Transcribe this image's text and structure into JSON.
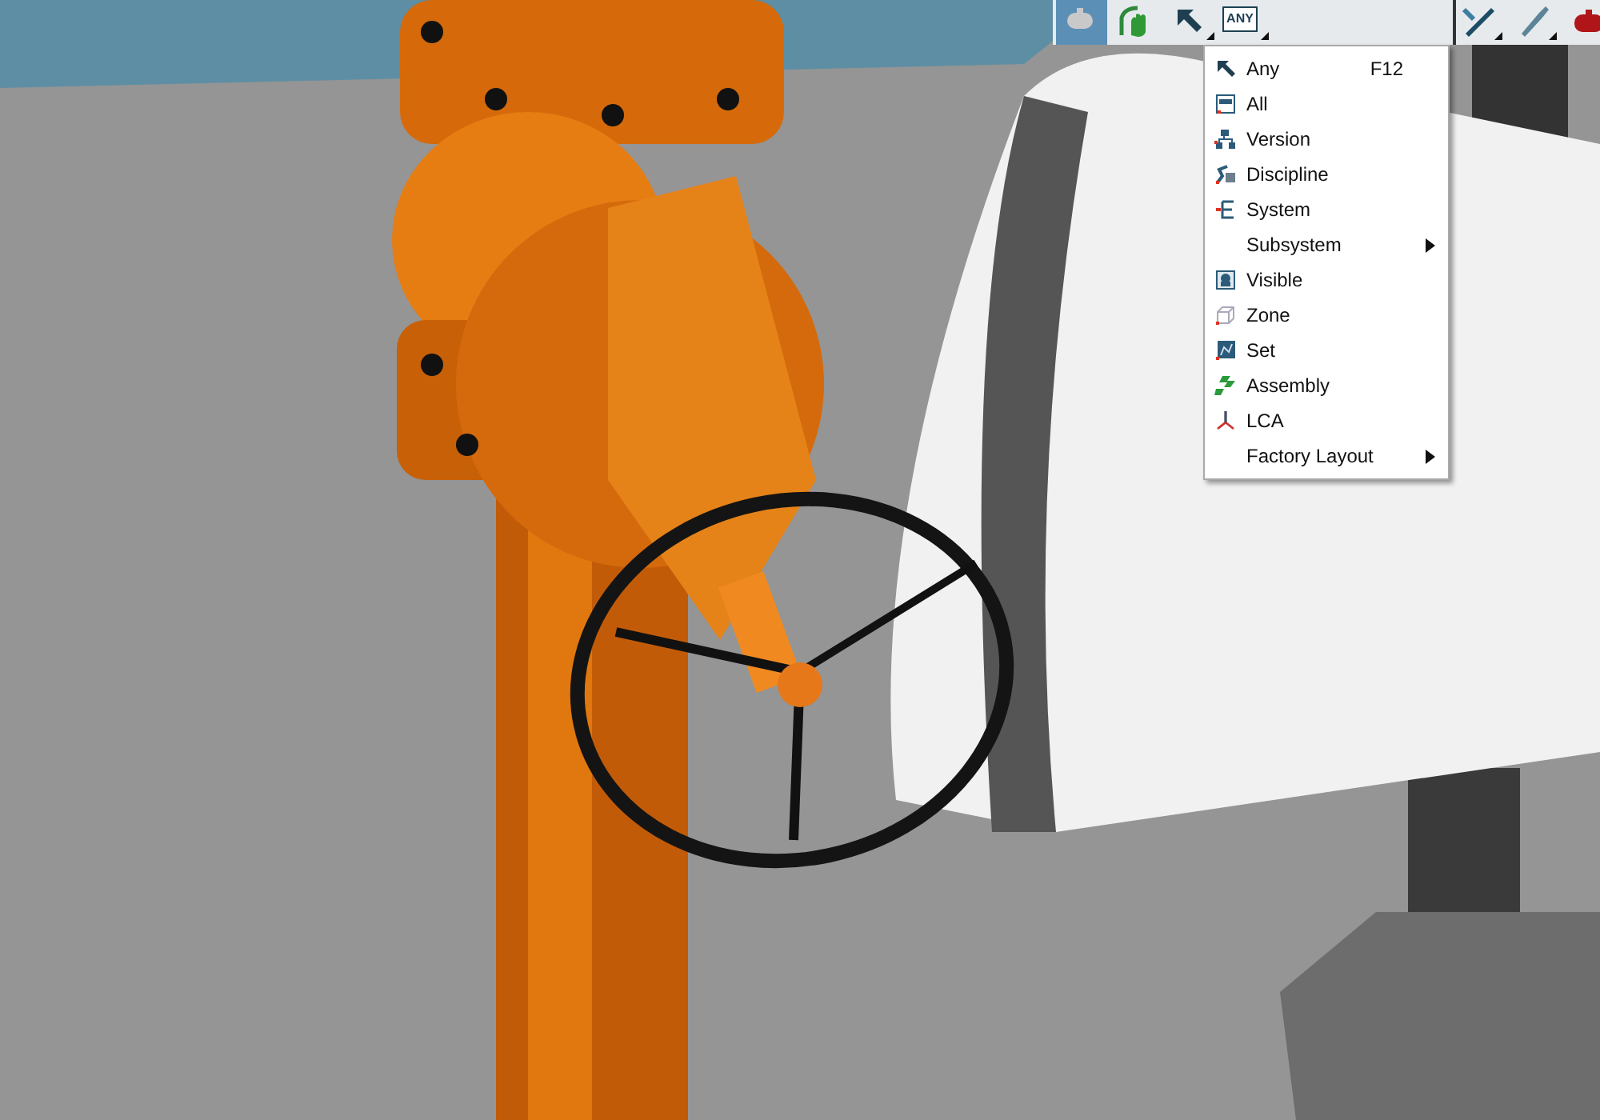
{
  "toolbar": {
    "buttons": [
      {
        "selected": true,
        "dropdown": false
      },
      {
        "selected": false,
        "dropdown": false
      },
      {
        "selected": false,
        "dropdown": true
      },
      {
        "selected": false,
        "dropdown": true,
        "label": "ANY"
      },
      {
        "selected": false,
        "dropdown": true
      },
      {
        "selected": false,
        "dropdown": true
      },
      {
        "selected": false,
        "dropdown": false
      }
    ]
  },
  "menu": {
    "items": [
      {
        "label": "Any",
        "shortcut": "F12",
        "has_submenu": false
      },
      {
        "label": "All",
        "has_submenu": false
      },
      {
        "label": "Version",
        "has_submenu": false
      },
      {
        "label": "Discipline",
        "has_submenu": false
      },
      {
        "label": "System",
        "has_submenu": false
      },
      {
        "label": "Subsystem",
        "has_submenu": true
      },
      {
        "label": "Visible",
        "has_submenu": false
      },
      {
        "label": "Zone",
        "has_submenu": false
      },
      {
        "label": "Set",
        "has_submenu": false
      },
      {
        "label": "Assembly",
        "has_submenu": false
      },
      {
        "label": "LCA",
        "has_submenu": false
      },
      {
        "label": "Factory Layout",
        "has_submenu": true
      }
    ]
  }
}
